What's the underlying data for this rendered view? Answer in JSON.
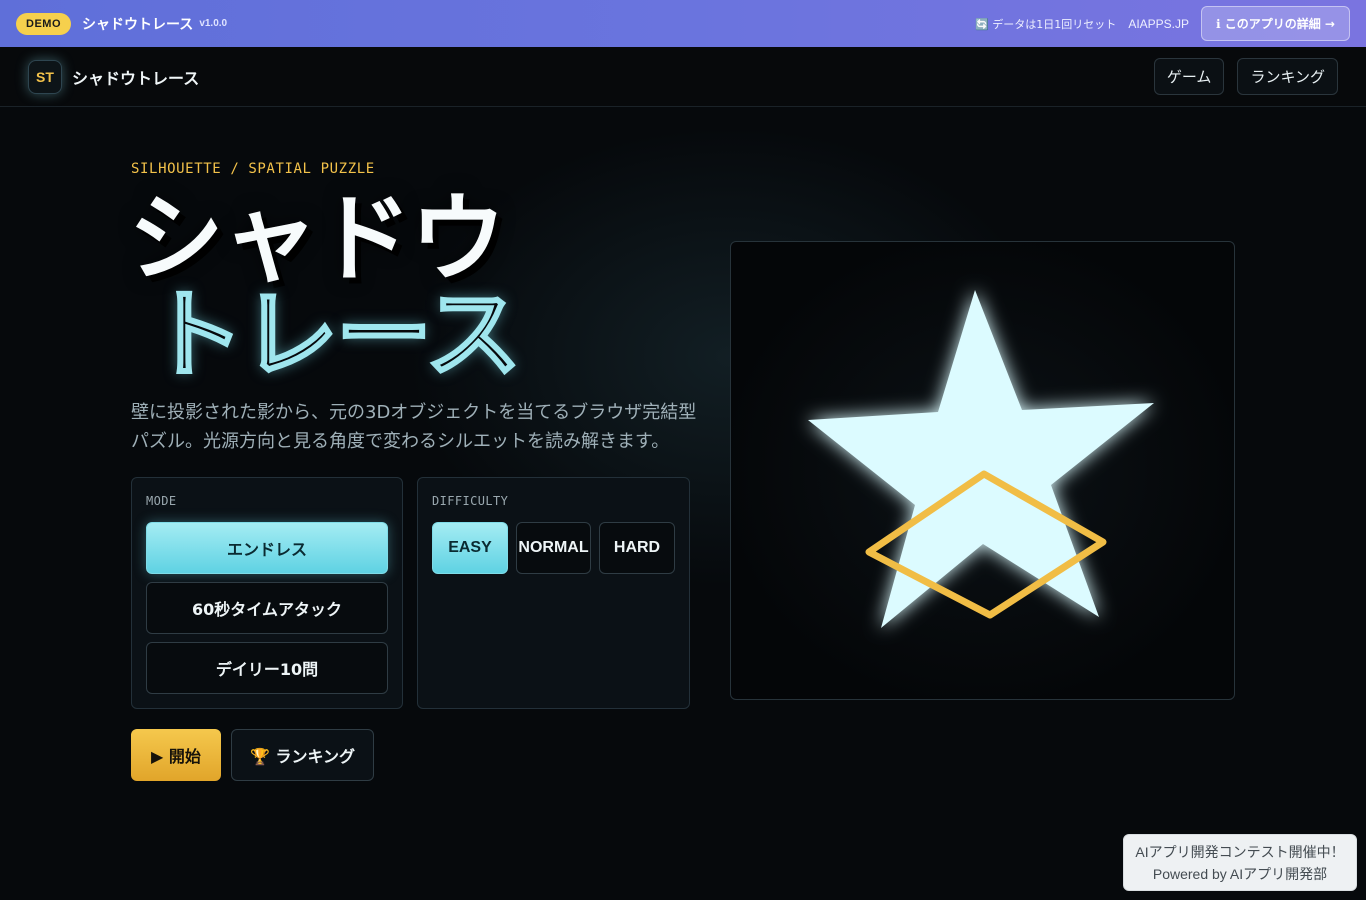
{
  "demo_bar": {
    "badge": "DEMO",
    "app_title": "シャドウトレース",
    "version": "v1.0.0",
    "reset_note": "🔄 データは1日1回リセット",
    "site": "AIAPPS.JP",
    "details_button": "ℹ このアプリの詳細 →"
  },
  "nav": {
    "logo": "ST",
    "brand": "シャドウトレース",
    "links": [
      "ゲーム",
      "ランキング"
    ]
  },
  "hero": {
    "eyebrow": "SILHOUETTE / SPATIAL PUZZLE",
    "title_line1": "シャドウ",
    "title_line2": "トレース",
    "description": "壁に投影された影から、元の3Dオブジェクトを当てるブラウザ完結型パズル。光源方向と見る角度で変わるシルエットを読み解きます。"
  },
  "mode": {
    "label": "MODE",
    "options": [
      "エンドレス",
      "60秒タイムアタック",
      "デイリー10問"
    ],
    "selected": "エンドレス"
  },
  "difficulty": {
    "label": "DIFFICULTY",
    "options": [
      "EASY",
      "NORMAL",
      "HARD"
    ],
    "selected": "EASY"
  },
  "actions": {
    "start": "▶ 開始",
    "ranking": "🏆 ランキング"
  },
  "preview": {
    "silhouette_shape": "star-icon",
    "outline_shape": "diamond-icon",
    "silhouette_color": "#dcfbff",
    "outline_color": "#f1bd45"
  },
  "contest": {
    "line1": "AIアプリ開発コンテスト開催中！",
    "line2": "Powered by AIアプリ開発部"
  },
  "colors": {
    "accent_cyan": "#7fdce8",
    "accent_gold": "#f3c24a",
    "demo_bar": "#6a74de"
  }
}
